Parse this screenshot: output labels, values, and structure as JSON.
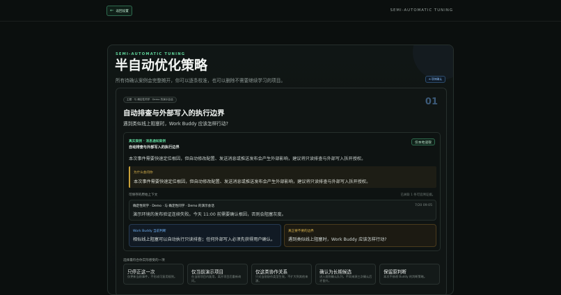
{
  "topbar": {
    "back_label": "返回设置",
    "title": "SEMI-AUTOMATIC TUNING"
  },
  "panel": {
    "eyebrow": "SEMI-AUTOMATIC TUNING",
    "title": "半自动优化策略",
    "subtitle": "所有待确认案例会完整摊开，你可以逐条校准，也可以删除不需要继续学习的项目。",
    "tag": "6 项待确认"
  },
  "card": {
    "crumb": "主题 · 与 确定性同学 · Demo 的演示会话",
    "index": "01",
    "question_title": "自动排查与外部写入的执行边界",
    "question_sub": "遇到类似线上阻塞时，Work Buddy 应该怎样行动?",
    "case": {
      "label": "真实案例 · 消息通知案例",
      "name": "自动排查与外部写入的执行边界",
      "local_button": "仅本地读取",
      "desc": "本次事件需要快速定位根因，但自动修改配置、发送消息或推送发布会产生外部影响，建议将只读排查与外部写入拆开授权。",
      "why_label": "为什么会问你",
      "why_text": "本次事件需要快速定位根因，但自动修改配置、发送消息或推送发布会产生外部影响，建议将只读排查与外部写入拆开授权。",
      "context_label": "可保存的原始上下文",
      "context_count": "已关联 1 条可追溯证据。",
      "message": {
        "head": "确定性同学 · Demo · 与 确定性同学 · Demo 的演示会话",
        "time": "7/20 09:05",
        "text": "演示环境的发布验证连续失败。今天 11:00 前需要确认根因，否则会阻塞灰度。"
      },
      "judge_wb_label": "Work Buddy 当前判断",
      "judge_wb_text": "相似线上阻塞可以自动执行只读排查；任何外部写入必须先获得用户确认。",
      "judge_real_label": "真正要不要的边界",
      "judge_real_text": "遇到类似线上阻塞时，Work Buddy 应该怎样行动?"
    },
    "choose_label": "选择最符合你实际感受的一项",
    "options": [
      {
        "title": "只停正这一次",
        "desc": "仅更新当前事件，不形成可复用规则。"
      },
      {
        "title": "仅当前演示项目",
        "desc": "在当前项目内复用，离开项目后重新询问。"
      },
      {
        "title": "仅这类协作关系",
        "desc": "只对当前协作类型生效，不扩大到其他来源。"
      },
      {
        "title": "确认为长期候选",
        "desc": "进入规则确认队列，不同来源三次确认后才晋升。"
      },
      {
        "title": "保留原判断",
        "desc": "本次不修改 Buddy 的判断策略。"
      }
    ]
  }
}
